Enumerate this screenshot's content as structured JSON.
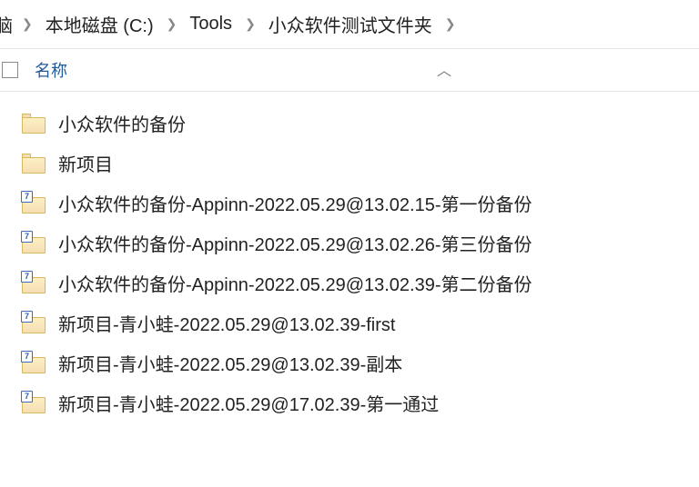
{
  "breadcrumb": {
    "truncated_first": "脑",
    "items": [
      "本地磁盘 (C:)",
      "Tools",
      "小众软件测试文件夹"
    ]
  },
  "columns": {
    "name": "名称"
  },
  "icons": {
    "badge_text": "7"
  },
  "files": [
    {
      "name": "小众软件的备份",
      "type": "folder"
    },
    {
      "name": "新项目",
      "type": "folder"
    },
    {
      "name": "小众软件的备份-Appinn-2022.05.29@13.02.15-第一份备份",
      "type": "archive"
    },
    {
      "name": "小众软件的备份-Appinn-2022.05.29@13.02.26-第三份备份",
      "type": "archive"
    },
    {
      "name": "小众软件的备份-Appinn-2022.05.29@13.02.39-第二份备份",
      "type": "archive"
    },
    {
      "name": "新项目-青小蛙-2022.05.29@13.02.39-first",
      "type": "archive"
    },
    {
      "name": "新项目-青小蛙-2022.05.29@13.02.39-副本",
      "type": "archive"
    },
    {
      "name": "新项目-青小蛙-2022.05.29@17.02.39-第一通过",
      "type": "archive"
    }
  ]
}
